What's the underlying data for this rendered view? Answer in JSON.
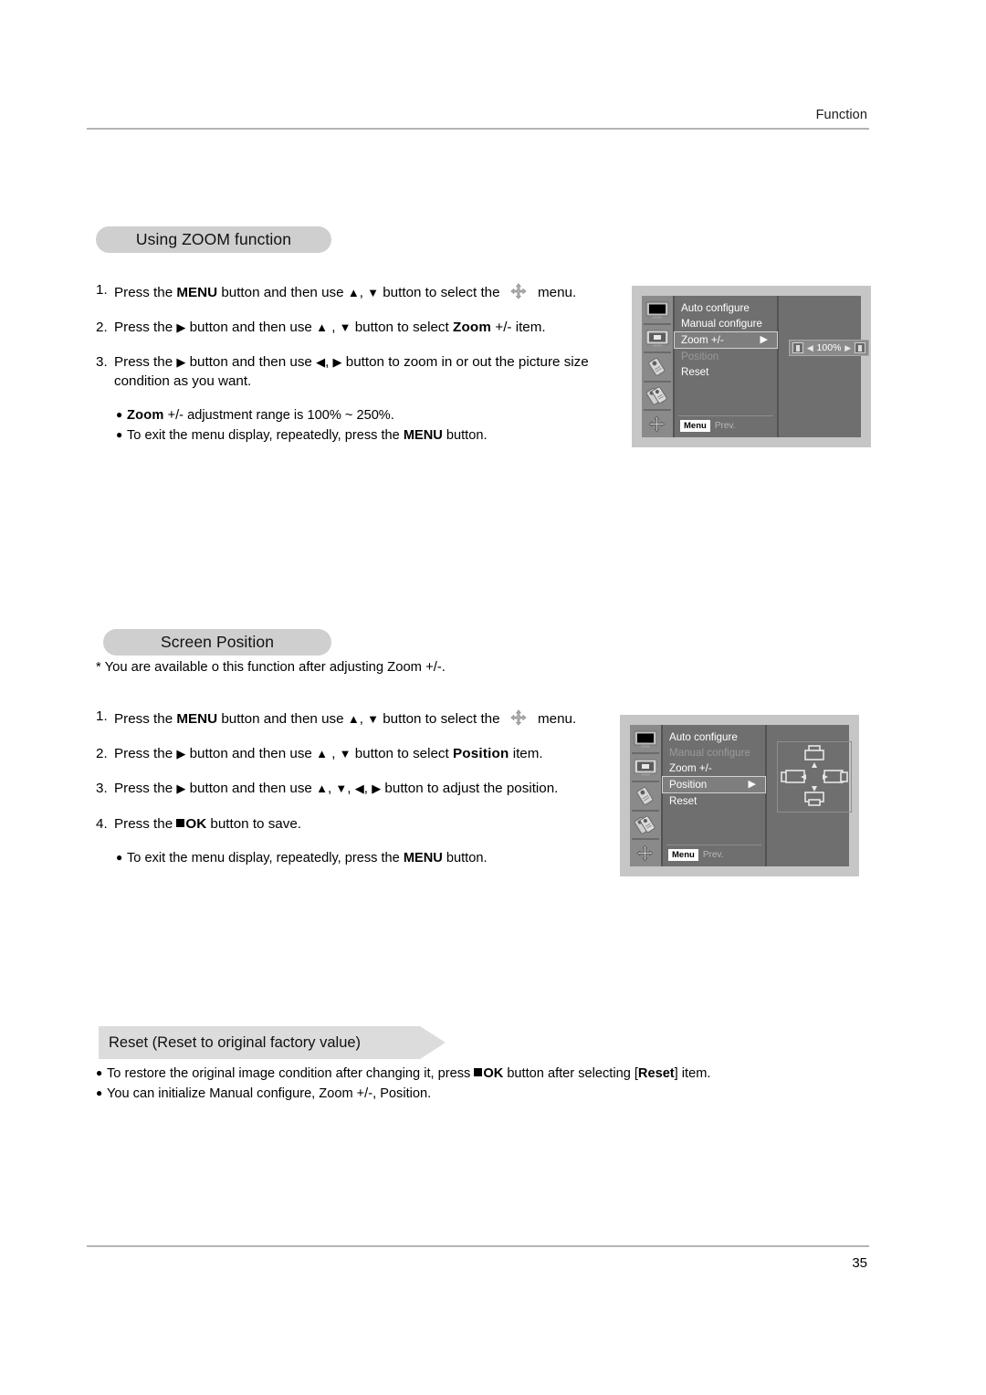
{
  "page": {
    "header_title": "Function",
    "page_number": "35"
  },
  "sections": {
    "zoom": {
      "heading": "Using ZOOM function",
      "steps": [
        {
          "num": "1.",
          "pre": "Press the ",
          "bold1": "MENU",
          "mid": " button and then use ",
          "g1": "▲",
          "g1sep": ", ",
          "g2": "▼",
          "post": " button to select the ",
          "icon": "move-icon",
          "tail": " menu."
        },
        {
          "num": "2.",
          "pre": "Press the ",
          "g1": "▶",
          "mid": " button and then use ",
          "g2": "▲",
          "g2sep": " , ",
          "g3": "▼",
          "post": " button to select ",
          "boldterm": "Zoom",
          "term2": " +/-",
          "tail": " item."
        },
        {
          "num": "3.",
          "pre": "Press the ",
          "g1": "▶",
          "mid": " button and then use ",
          "g2": "◀",
          "g2sep": ", ",
          "g3": "▶",
          "post": " button to zoom in or out the picture size condition as you want."
        }
      ],
      "bullets": [
        {
          "boldterm": "Zoom",
          "term2": " +/-",
          "rest": " adjustment range is 100% ~ 250%."
        },
        {
          "pre": "To exit the menu display, repeatedly, press the ",
          "bold": "MENU",
          "post": " button."
        }
      ]
    },
    "position": {
      "heading": "Screen Position",
      "note": "* You are available o this function after adjusting Zoom +/-.",
      "steps": [
        {
          "num": "1.",
          "pre": "Press the ",
          "bold1": "MENU",
          "mid": " button and then use ",
          "g1": "▲",
          "g1sep": ", ",
          "g2": "▼",
          "post": " button to select the ",
          "icon": "move-icon",
          "tail": " menu."
        },
        {
          "num": "2.",
          "pre": "Press the ",
          "g1": "▶",
          "mid": " button and then use ",
          "g2": "▲",
          "g2sep": " , ",
          "g3": "▼",
          "post": " button to select ",
          "boldterm": "Position",
          "tail": " item."
        },
        {
          "num": "3.",
          "pre": "Press the ",
          "g1": "▶",
          "mid": " button and then use ",
          "g2": "▲",
          "g2sep": ", ",
          "g3": "▼",
          "g3sep": ", ",
          "g4": "◀",
          "g4sep": ", ",
          "g5": "▶",
          "post": " button to adjust the position."
        },
        {
          "num": "4.",
          "pre": "Press the ",
          "oksquare": true,
          "bold1": "OK",
          "post": " button to save."
        }
      ],
      "bullets": [
        {
          "pre": "To exit the menu display, repeatedly, press the ",
          "bold": "MENU",
          "post": " button."
        }
      ]
    },
    "reset": {
      "heading": "Reset (Reset to original factory value)",
      "bullets": [
        {
          "pre": "To restore the original image condition after changing it, press ",
          "oksquare": true,
          "bold1": "OK",
          "mid": " button after selecting [",
          "bold2": "Reset",
          "post": "] item."
        },
        {
          "plain": "You can initialize Manual configure, Zoom +/-, Position."
        }
      ]
    }
  },
  "osd_zoom": {
    "items": [
      {
        "label": "Auto configure",
        "state": "normal",
        "arrow": ""
      },
      {
        "label": "Manual configure",
        "state": "normal",
        "arrow": ""
      },
      {
        "label": "Zoom +/-",
        "state": "selected",
        "arrow": "▶"
      },
      {
        "label": "Position",
        "state": "disabled",
        "arrow": ""
      },
      {
        "label": "Reset",
        "state": "normal",
        "arrow": ""
      }
    ],
    "footer": {
      "key": "Menu",
      "label": "Prev."
    },
    "value_widget": {
      "left_tri": "◀",
      "value": "100%",
      "right_tri": "▶"
    },
    "rail_icons": [
      "screen-filled-icon",
      "screen-box-icon",
      "tag-icon",
      "double-tag-icon",
      "move-icon"
    ]
  },
  "osd_position": {
    "items": [
      {
        "label": "Auto configure",
        "state": "normal",
        "arrow": ""
      },
      {
        "label": "Manual configure",
        "state": "disabled",
        "arrow": ""
      },
      {
        "label": "Zoom +/-",
        "state": "normal",
        "arrow": ""
      },
      {
        "label": "Position",
        "state": "selected",
        "arrow": "▶"
      },
      {
        "label": "Reset",
        "state": "normal",
        "arrow": ""
      }
    ],
    "footer": {
      "key": "Menu",
      "label": "Prev."
    },
    "rail_icons": [
      "screen-filled-icon",
      "screen-box-icon",
      "tag-icon",
      "double-tag-icon",
      "move-icon"
    ]
  },
  "colors": {
    "pill_bg": "#cfcfcf",
    "banner_bg": "#dcdcdc",
    "osd_frame": "#c6c6c6",
    "osd_body": "#6f6f6f",
    "osd_rail": "#8a8a8a",
    "rule": "#b4b4b4"
  }
}
